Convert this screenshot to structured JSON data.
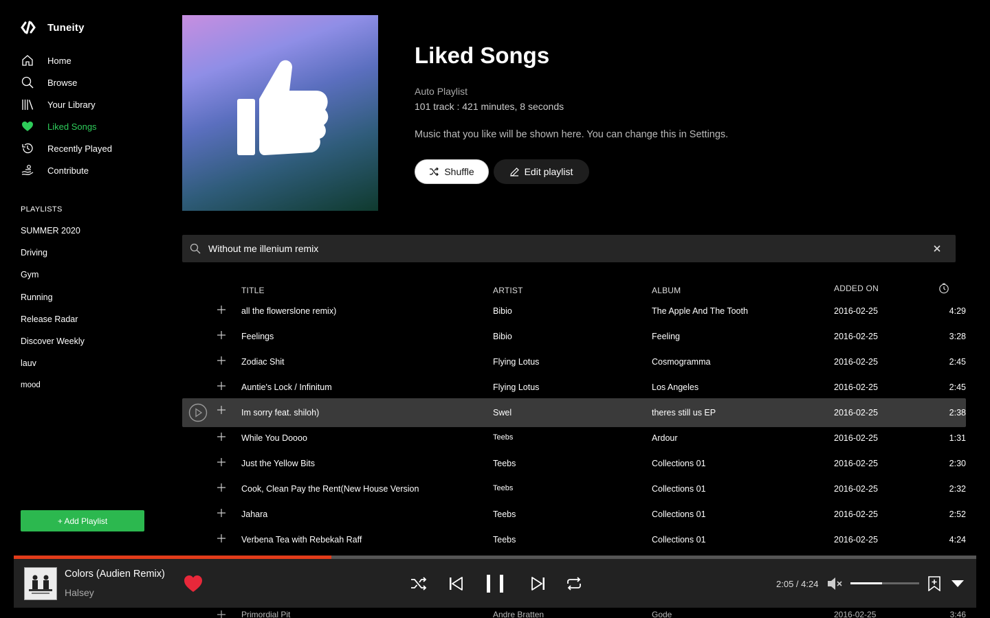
{
  "app": {
    "name": "Tuneity"
  },
  "sidebar": {
    "nav": [
      {
        "label": "Home",
        "icon": "home-icon"
      },
      {
        "label": "Browse",
        "icon": "search-icon"
      },
      {
        "label": "Your Library",
        "icon": "library-icon"
      },
      {
        "label": "Liked Songs",
        "icon": "heart-icon",
        "active": true
      },
      {
        "label": "Recently Played",
        "icon": "history-icon"
      },
      {
        "label": "Contribute",
        "icon": "contribute-icon"
      }
    ],
    "playlists_heading": "PLAYLISTS",
    "playlists": [
      "SUMMER 2020",
      "Driving",
      "Gym",
      "Running",
      "Release Radar",
      "Discover Weekly",
      "lauv",
      "mood"
    ],
    "add_playlist_label": "+ Add Playlist"
  },
  "header": {
    "title": "Liked Songs",
    "type": "Auto Playlist",
    "stats": "101 track : 421 minutes, 8 seconds",
    "description": "Music that you like will be shown here. You can change this in Settings.",
    "shuffle_label": "Shuffle",
    "edit_label": "Edit playlist"
  },
  "search": {
    "value": "Without me illenium remix"
  },
  "table": {
    "columns": {
      "title": "TITLE",
      "artist": "ARTIST",
      "album": "ALBUM",
      "added": "ADDED ON"
    },
    "rows": [
      {
        "title": "all the flowerslone remix)",
        "artist": "Bibio",
        "album": "The Apple And The Tooth",
        "added": "2016-02-25",
        "duration": "4:29"
      },
      {
        "title": "Feelings",
        "artist": "Bibio",
        "album": "Feeling",
        "added": "2016-02-25",
        "duration": "3:28"
      },
      {
        "title": "Zodiac Shit",
        "artist": "Flying Lotus",
        "album": "Cosmogramma",
        "added": "2016-02-25",
        "duration": "2:45"
      },
      {
        "title": "Auntie's Lock / Infinitum",
        "artist": "Flying Lotus",
        "album": "Los Angeles",
        "added": "2016-02-25",
        "duration": "2:45"
      },
      {
        "title": "Im sorry feat. shiloh)",
        "artist": "Swel",
        "album": "theres still us EP",
        "added": "2016-02-25",
        "duration": "2:38"
      },
      {
        "title": "While You Doooo",
        "artist": "Teebs",
        "album": "Ardour",
        "added": "2016-02-25",
        "duration": "1:31"
      },
      {
        "title": "Just the Yellow Bits",
        "artist": "Teebs",
        "album": "Collections 01",
        "added": "2016-02-25",
        "duration": "2:30"
      },
      {
        "title": "Cook, Clean Pay the Rent(New House Version",
        "artist": "Teebs",
        "album": "Collections 01",
        "added": "2016-02-25",
        "duration": "2:32"
      },
      {
        "title": "Jahara",
        "artist": "Teebs",
        "album": "Collections 01",
        "added": "2016-02-25",
        "duration": "2:52"
      },
      {
        "title": "Verbena Tea with Rebekah Raff",
        "artist": "Teebs",
        "album": "Collections 01",
        "added": "2016-02-25",
        "duration": "4:24"
      }
    ],
    "partial_row": {
      "title": "Primordial Pit",
      "artist": "Andre Bratten",
      "album": "Gode",
      "added": "2016-02-25",
      "duration": "3:46"
    }
  },
  "player": {
    "title": "Colors (Audien Remix)",
    "artist": "Halsey",
    "time": "2:05 / 4:24",
    "progress": 0.33,
    "volume": 0.46,
    "accent": "#e23c1a",
    "liked_color": "#e8283a"
  },
  "colors": {
    "brand_green": "#2cb84f",
    "active_green": "#2ecc5a"
  }
}
